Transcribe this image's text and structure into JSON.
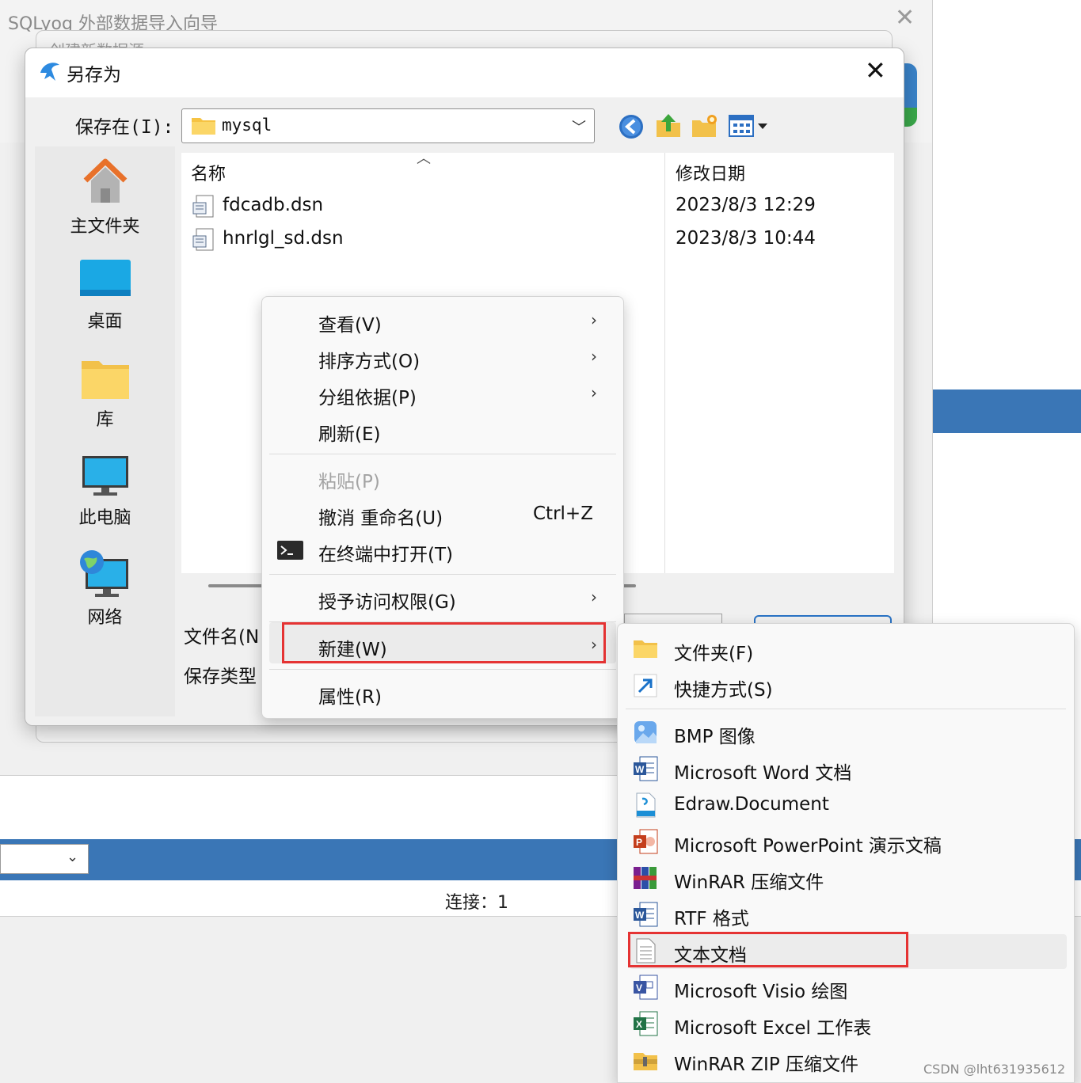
{
  "background_app": {
    "title": "SQLyog 外部数据导入向导",
    "wizard_title": "创建新数据源",
    "status_text": "连接：1"
  },
  "dialog": {
    "title": "另存为",
    "save_in_label": "保存在(I):",
    "current_folder": "mysql",
    "filename_label": "文件名(N",
    "filetype_label": "保存类型"
  },
  "places": [
    {
      "label": "主文件夹",
      "icon": "home-icon"
    },
    {
      "label": "桌面",
      "icon": "desktop-icon"
    },
    {
      "label": "库",
      "icon": "library-icon"
    },
    {
      "label": "此电脑",
      "icon": "computer-icon"
    },
    {
      "label": "网络",
      "icon": "network-icon"
    }
  ],
  "file_list": {
    "columns": [
      "名称",
      "修改日期"
    ],
    "rows": [
      {
        "name": "fdcadb.dsn",
        "date": "2023/8/3 12:29"
      },
      {
        "name": "hnrlgl_sd.dsn",
        "date": "2023/8/3 10:44"
      }
    ]
  },
  "context_menu": {
    "items": [
      {
        "label": "查看(V)",
        "submenu": true
      },
      {
        "label": "排序方式(O)",
        "submenu": true
      },
      {
        "label": "分组依据(P)",
        "submenu": true
      },
      {
        "label": "刷新(E)",
        "submenu": false
      },
      {
        "label": "粘贴(P)",
        "disabled": true
      },
      {
        "label": "撤消 重命名(U)",
        "shortcut": "Ctrl+Z"
      },
      {
        "label": "在终端中打开(T)",
        "icon": "terminal-icon"
      },
      {
        "label": "授予访问权限(G)",
        "submenu": true
      },
      {
        "label": "新建(W)",
        "submenu": true,
        "highlighted": true
      },
      {
        "label": "属性(R)",
        "submenu": false
      }
    ]
  },
  "new_submenu": {
    "items": [
      {
        "label": "文件夹(F)",
        "icon": "folder-icon"
      },
      {
        "label": "快捷方式(S)",
        "icon": "shortcut-icon"
      },
      {
        "label": "BMP 图像",
        "icon": "bmp-icon"
      },
      {
        "label": "Microsoft Word 文档",
        "icon": "word-icon"
      },
      {
        "label": "Edraw.Document",
        "icon": "edraw-icon"
      },
      {
        "label": "Microsoft PowerPoint 演示文稿",
        "icon": "powerpoint-icon"
      },
      {
        "label": "WinRAR 压缩文件",
        "icon": "winrar-icon"
      },
      {
        "label": "RTF 格式",
        "icon": "rtf-icon"
      },
      {
        "label": "文本文档",
        "icon": "text-document-icon",
        "highlighted": true
      },
      {
        "label": "Microsoft Visio 绘图",
        "icon": "visio-icon"
      },
      {
        "label": "Microsoft Excel 工作表",
        "icon": "excel-icon"
      },
      {
        "label": "WinRAR ZIP 压缩文件",
        "icon": "winrar-zip-icon"
      }
    ]
  },
  "watermark": "CSDN @lht631935612",
  "colors": {
    "accent_blue": "#3a76b6",
    "highlight_red": "#e53333"
  }
}
